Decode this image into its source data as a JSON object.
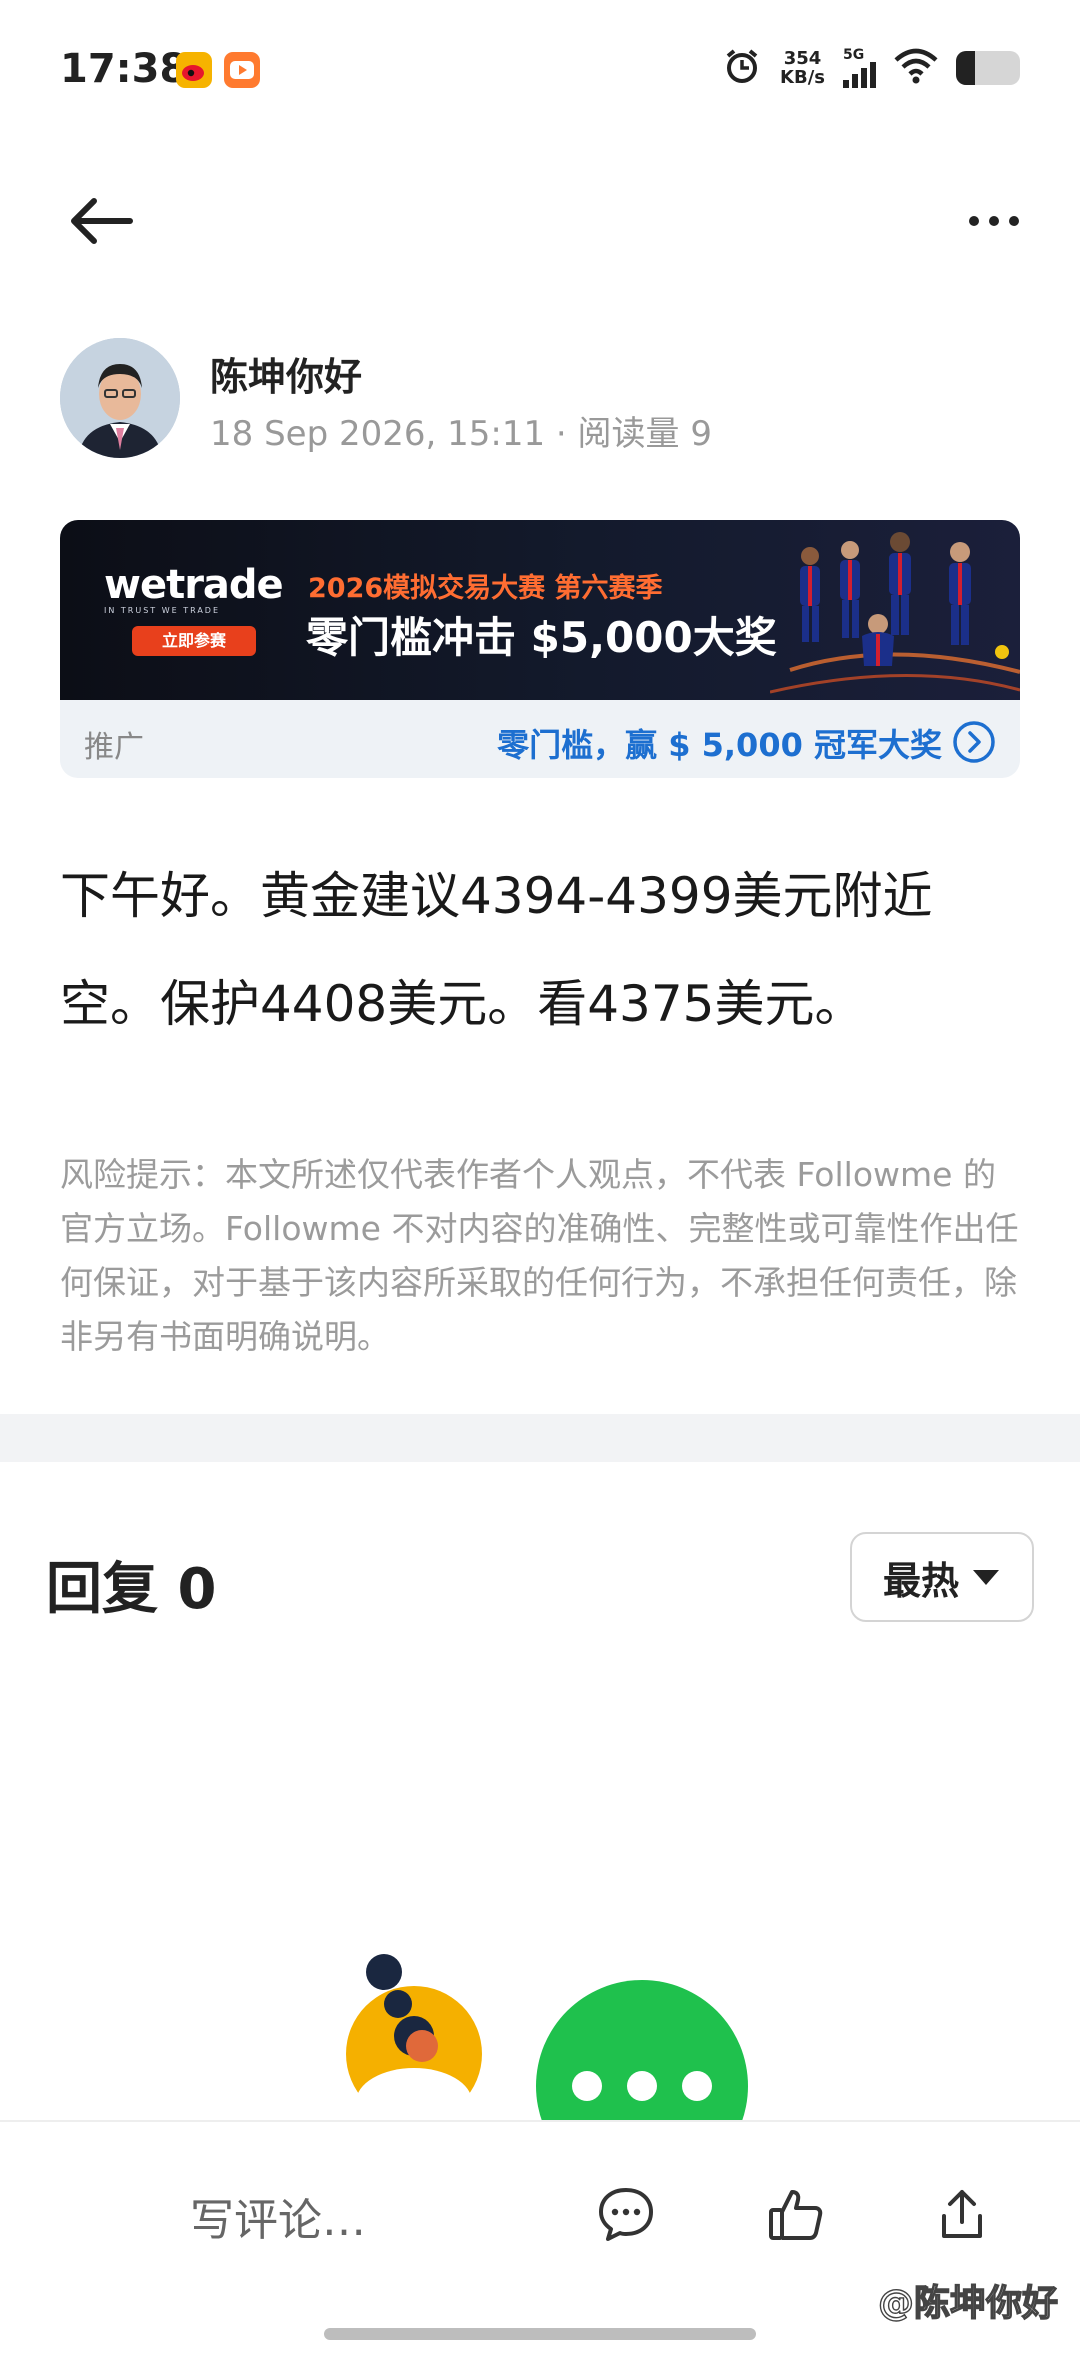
{
  "status_bar": {
    "time": "17:38",
    "net_speed_value": "354",
    "net_speed_unit": "KB/s",
    "signal_type": "5G",
    "battery_level": 0.3
  },
  "nav": {
    "back_icon": "arrow-left-icon",
    "more_icon": "more-horizontal-icon"
  },
  "author": {
    "name": "陈坤你好",
    "meta": "18 Sep 2026, 15:11 · 阅读量 9"
  },
  "ad": {
    "brand": "wetrade",
    "brand_tagline": "IN TRUST WE TRADE",
    "join_button": "立即参赛",
    "headline_1": "2026模拟交易大赛 第六赛季",
    "headline_2": "零门槛冲击 $5,000大奖",
    "label": "推广",
    "promo_text": "零门槛，赢 $ 5,000 冠军大奖"
  },
  "post": {
    "content": "下午好。黄金建议4394-4399美元附近空。保护4408美元。看4375美元。"
  },
  "disclaimer": "风险提示：本文所述仅代表作者个人观点，不代表 Followme 的官方立场。Followme 不对内容的准确性、完整性或可靠性作出任何保证，对于基于该内容所采取的任何行为，不承担任何责任，除非另有书面明确说明。",
  "replies": {
    "title": "回复 0",
    "sort_label": "最热"
  },
  "bottom_bar": {
    "comment_placeholder": "写评论…",
    "watermark": "@陈坤你好"
  },
  "colors": {
    "accent_blue": "#1d6fd0",
    "ad_orange": "#ff6d32",
    "empty_green": "#1fc14d"
  }
}
